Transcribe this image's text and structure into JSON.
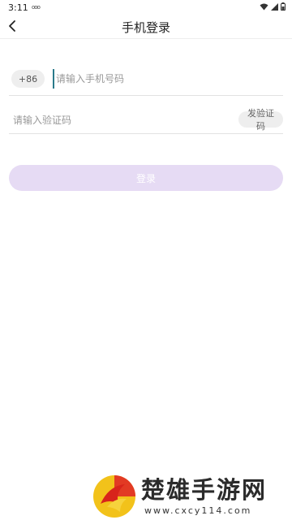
{
  "status_bar": {
    "time": "3:11",
    "notification": "ooo"
  },
  "nav": {
    "title": "手机登录"
  },
  "phone": {
    "country_code": "+86",
    "placeholder": "请输入手机号码"
  },
  "code": {
    "placeholder": "请输入验证码",
    "send_label": "发验证码"
  },
  "login": {
    "label": "登录"
  },
  "watermark": {
    "name": "楚雄手游网",
    "url": "www.cxcy114.com"
  },
  "colors": {
    "login_bg": "#e6dbf4",
    "pill_bg": "#eeeeee",
    "divider": "#e2e2e2",
    "cursor": "#2a7a8a"
  }
}
